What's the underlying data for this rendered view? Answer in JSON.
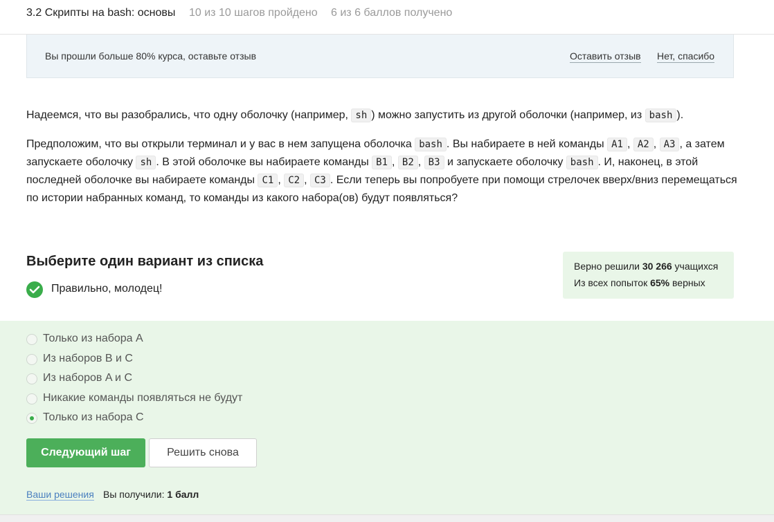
{
  "header": {
    "lesson_title": "3.2 Скрипты на bash: основы",
    "steps_progress": "10 из 10 шагов пройдено",
    "points_progress": "6 из 6 баллов  получено"
  },
  "review_banner": {
    "message": "Вы прошли больше 80% курса, оставьте отзыв",
    "leave_review": "Оставить отзыв",
    "no_thanks": "Нет, спасибо"
  },
  "content": {
    "p1": {
      "t1": "Надеемся, что вы разобрались, что одну оболочку (например, ",
      "c1": "sh",
      "t2": ") можно запустить из другой оболочки (например, из ",
      "c2": "bash",
      "t3": ")."
    },
    "p2": {
      "t1": "Предположим, что вы открыли терминал и у вас в нем запущена оболочка ",
      "c_bash1": "bash",
      "t2": ". Вы набираете в ней команды ",
      "a1": "A1",
      "sep1": ", ",
      "a2": "A2",
      "sep2": ", ",
      "a3": "A3",
      "t3": ", а затем запускаете оболочку ",
      "c_sh": "sh",
      "t4": ". В этой оболочке вы набираете команды ",
      "b1": "B1",
      "sep3": ", ",
      "b2": "B2",
      "sep4": ", ",
      "b3": "B3",
      "t5": " и запускаете оболочку ",
      "c_bash2": "bash",
      "t6": ". И, наконец, в этой последней оболочке вы набираете команды ",
      "c1": "C1",
      "sep5": ", ",
      "c2": "C2",
      "sep6": ", ",
      "c3": "C3",
      "t7": ". Если теперь вы попробуете при помощи стрелочек вверх/вниз перемещаться по истории набранных команд, то команды из какого набора(ов) будут появляться?"
    }
  },
  "quiz": {
    "heading": "Выберите один вариант из списка",
    "feedback": "Правильно, молодец!",
    "stats": {
      "line1_prefix": "Верно решили ",
      "line1_value": "30 266",
      "line1_suffix": " учащихся",
      "line2_prefix": "Из всех попыток ",
      "line2_value": "65%",
      "line2_suffix": " верных"
    },
    "options": [
      {
        "label": "Только из набора A",
        "selected": false
      },
      {
        "label": "Из наборов B и C",
        "selected": false
      },
      {
        "label": "Из наборов A и C",
        "selected": false
      },
      {
        "label": "Никакие команды появляться не будут",
        "selected": false
      },
      {
        "label": "Только из набора C",
        "selected": true
      }
    ],
    "next_button": "Следующий шаг",
    "retry_button": "Решить снова",
    "solutions_link": "Ваши решения",
    "received_prefix": "Вы получили: ",
    "received_value": "1 балл"
  },
  "colors": {
    "accent_green": "#4caf5a",
    "success_bg": "#e9f6e8",
    "banner_bg": "#eef4f8",
    "link_blue": "#4a7fbf"
  }
}
